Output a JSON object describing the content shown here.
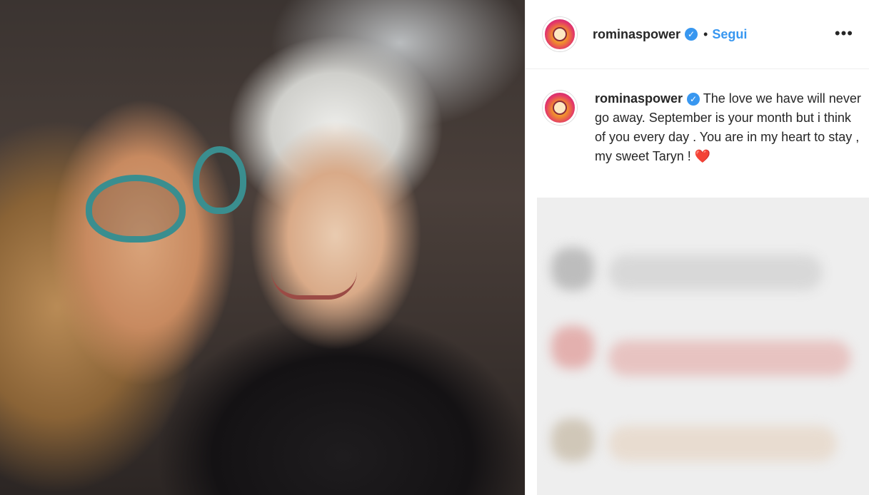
{
  "post": {
    "username": "rominaspower",
    "verified_icon": "verified-badge-icon",
    "separator": "•",
    "follow_label": "Segui",
    "more_label": "•••"
  },
  "caption": {
    "username": "rominaspower",
    "text": "The love we have will never go away. September is your month but i think of you every day . You are in my heart to stay , my sweet Taryn ! ",
    "emoji": "❤️"
  },
  "colors": {
    "link": "#3897f0",
    "text": "#262626",
    "heart": "#e0245e"
  }
}
